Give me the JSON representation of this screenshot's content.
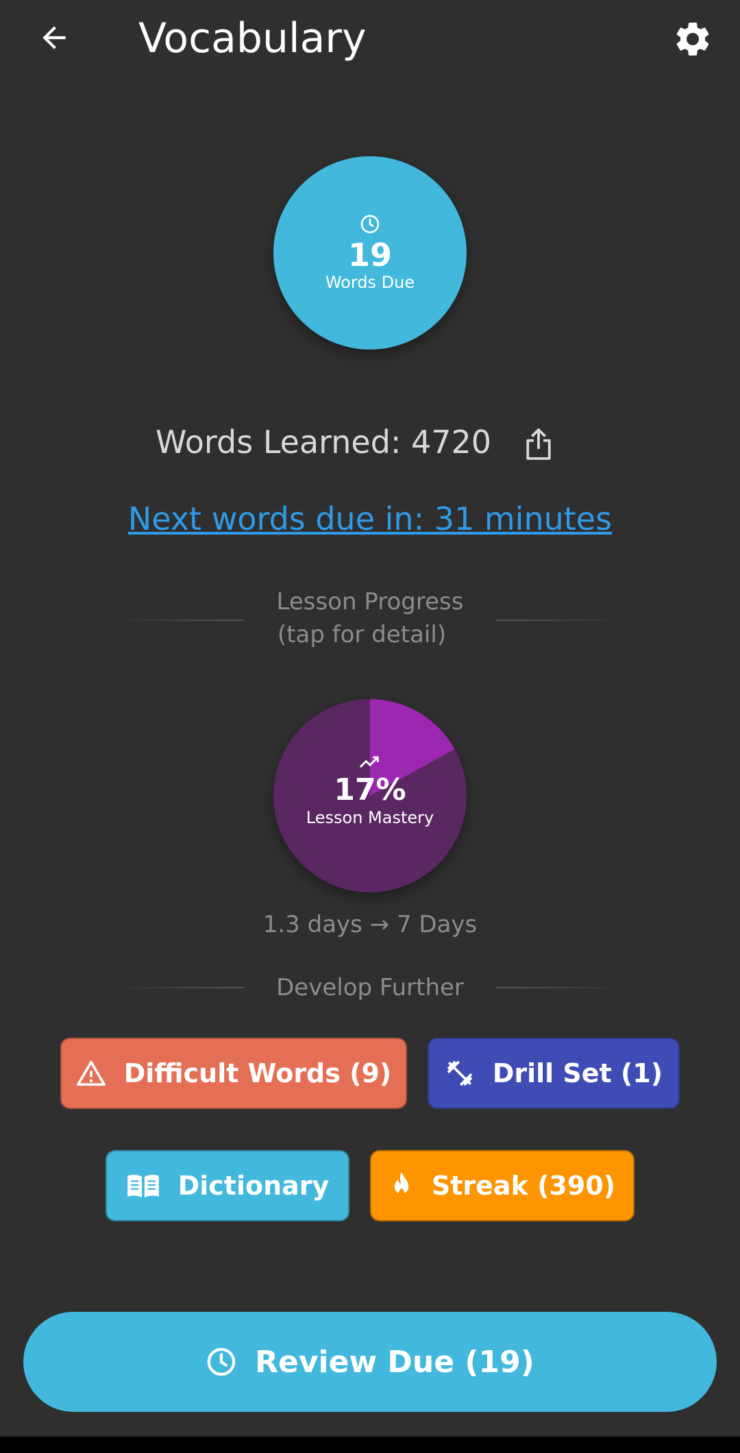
{
  "header": {
    "title": "Vocabulary"
  },
  "due": {
    "count": "19",
    "label": "Words Due"
  },
  "stats": {
    "words_learned": "Words Learned: 4720",
    "next_due": "Next words due in: 31 minutes"
  },
  "progress": {
    "heading_line1": "Lesson Progress",
    "heading_line2": "(tap for detail)",
    "mastery_percent": "17%",
    "mastery_fraction": 0.17,
    "mastery_label": "Lesson Mastery",
    "days_range": "1.3 days → 7 Days"
  },
  "develop": {
    "heading": "Develop Further",
    "difficult_label": "Difficult Words (9)",
    "drill_label": "Drill Set (1)",
    "dictionary_label": "Dictionary",
    "streak_label": "Streak (390)"
  },
  "review": {
    "label": "Review Due (19)"
  },
  "colors": {
    "background": "#2f2f2f",
    "accent_blue": "#41b8dc",
    "link_blue": "#2f9ae8",
    "mastery_bg": "#5b2763",
    "mastery_fill": "#9c27b0",
    "difficult": "#e56f55",
    "drill": "#3f4cb5",
    "streak": "#fe9500"
  }
}
